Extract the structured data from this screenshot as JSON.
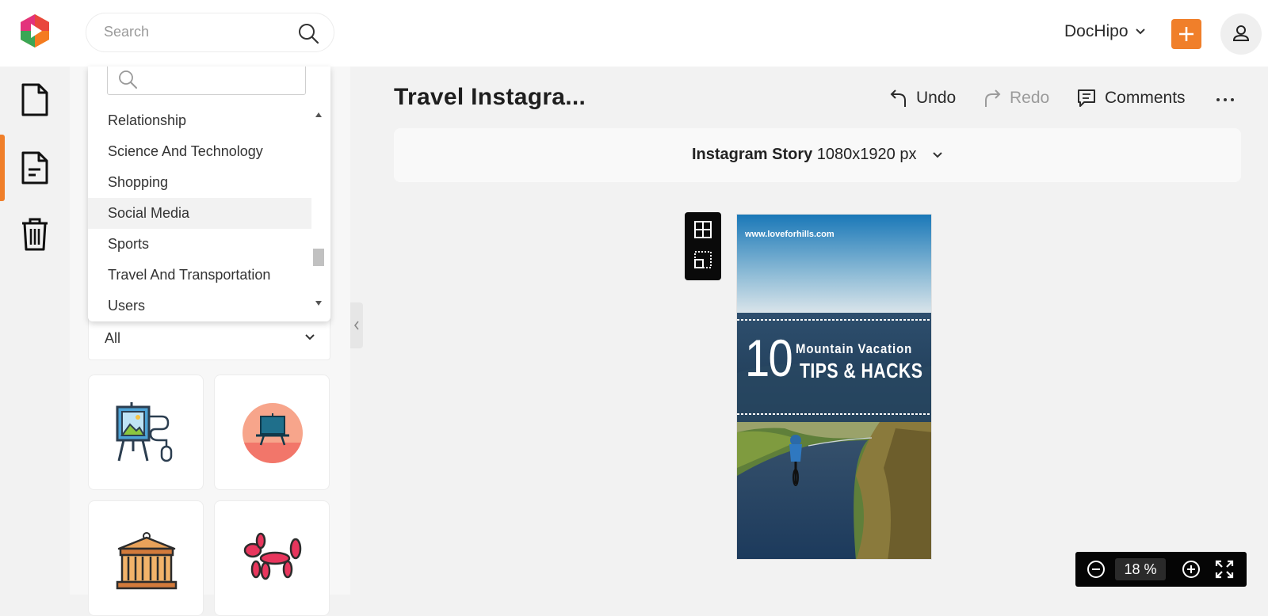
{
  "header": {
    "search_placeholder": "Search",
    "account_label": "DocHipo"
  },
  "panel": {
    "dropdown": {
      "search_value": "",
      "items": [
        "Relationship",
        "Science And Technology",
        "Shopping",
        "Social Media",
        "Sports",
        "Travel And Transportation",
        "Users"
      ],
      "highlighted": "Social Media"
    },
    "filter_value": "All"
  },
  "editor": {
    "title": "Travel Instagra...",
    "undo_label": "Undo",
    "redo_label": "Redo",
    "comments_label": "Comments",
    "size": {
      "name": "Instagram Story",
      "dimensions": "1080x1920 px"
    },
    "design": {
      "url": "www.loveforhills.com",
      "number": "10",
      "line1": "Mountain Vacation",
      "line2": "TIPS & HACKS"
    },
    "zoom_value": "18",
    "zoom_unit": "%"
  },
  "colors": {
    "accent": "#f07f2a",
    "toolbar_dark": "#050505"
  }
}
